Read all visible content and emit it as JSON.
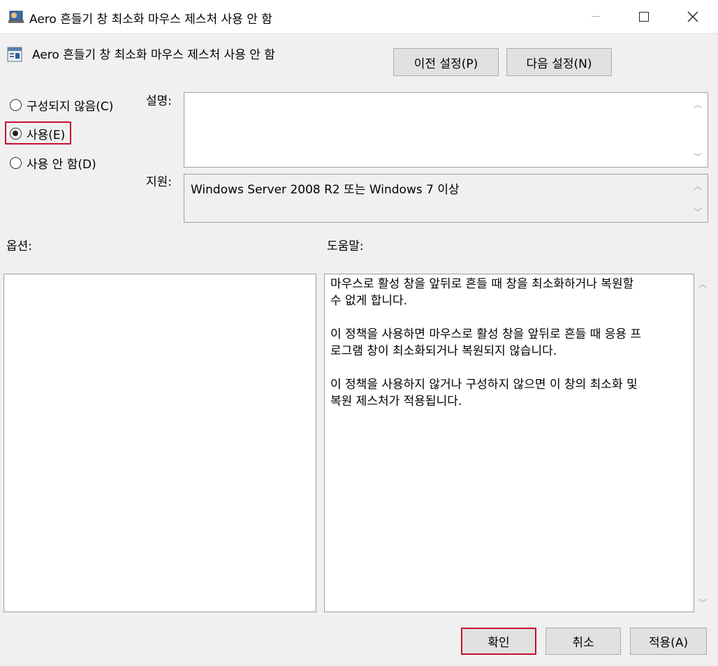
{
  "window": {
    "title": "Aero 흔들기 창 최소화 마우스 제스처 사용 안 함",
    "icons": [
      "app-icon",
      "minimize-icon",
      "maximize-icon",
      "close-icon"
    ]
  },
  "header": {
    "policy_name": "Aero 흔들기 창 최소화 마우스 제스처 사용 안 함",
    "prev_button": "이전 설정(P)",
    "next_button": "다음 설정(N)"
  },
  "state": {
    "options": [
      {
        "label": "구성되지 않음(C)",
        "checked": false
      },
      {
        "label": "사용(E)",
        "checked": true
      },
      {
        "label": "사용 안 함(D)",
        "checked": false
      }
    ]
  },
  "description": {
    "label": "설명:",
    "text": ""
  },
  "support": {
    "label": "지원:",
    "text": "Windows Server 2008 R2 또는 Windows 7 이상"
  },
  "options_panel": {
    "label": "옵션:"
  },
  "help_panel": {
    "label": "도움말:",
    "text": "마우스로 활성 창을 앞뒤로 흔들 때 창을 최소화하거나 복원할\n수 없게 합니다.\n\n이 정책을 사용하면 마우스로 활성 창을 앞뒤로 흔들 때 응용 프\n로그램 창이 최소화되거나 복원되지 않습니다.\n\n이 정책을 사용하지 않거나 구성하지 않으면 이 창의 최소화 및\n복원 제스처가 적용됩니다."
  },
  "footer": {
    "ok": "확인",
    "cancel": "취소",
    "apply": "적용(A)"
  },
  "colors": {
    "highlight": "#c8102e",
    "background": "#f0f0f0"
  }
}
